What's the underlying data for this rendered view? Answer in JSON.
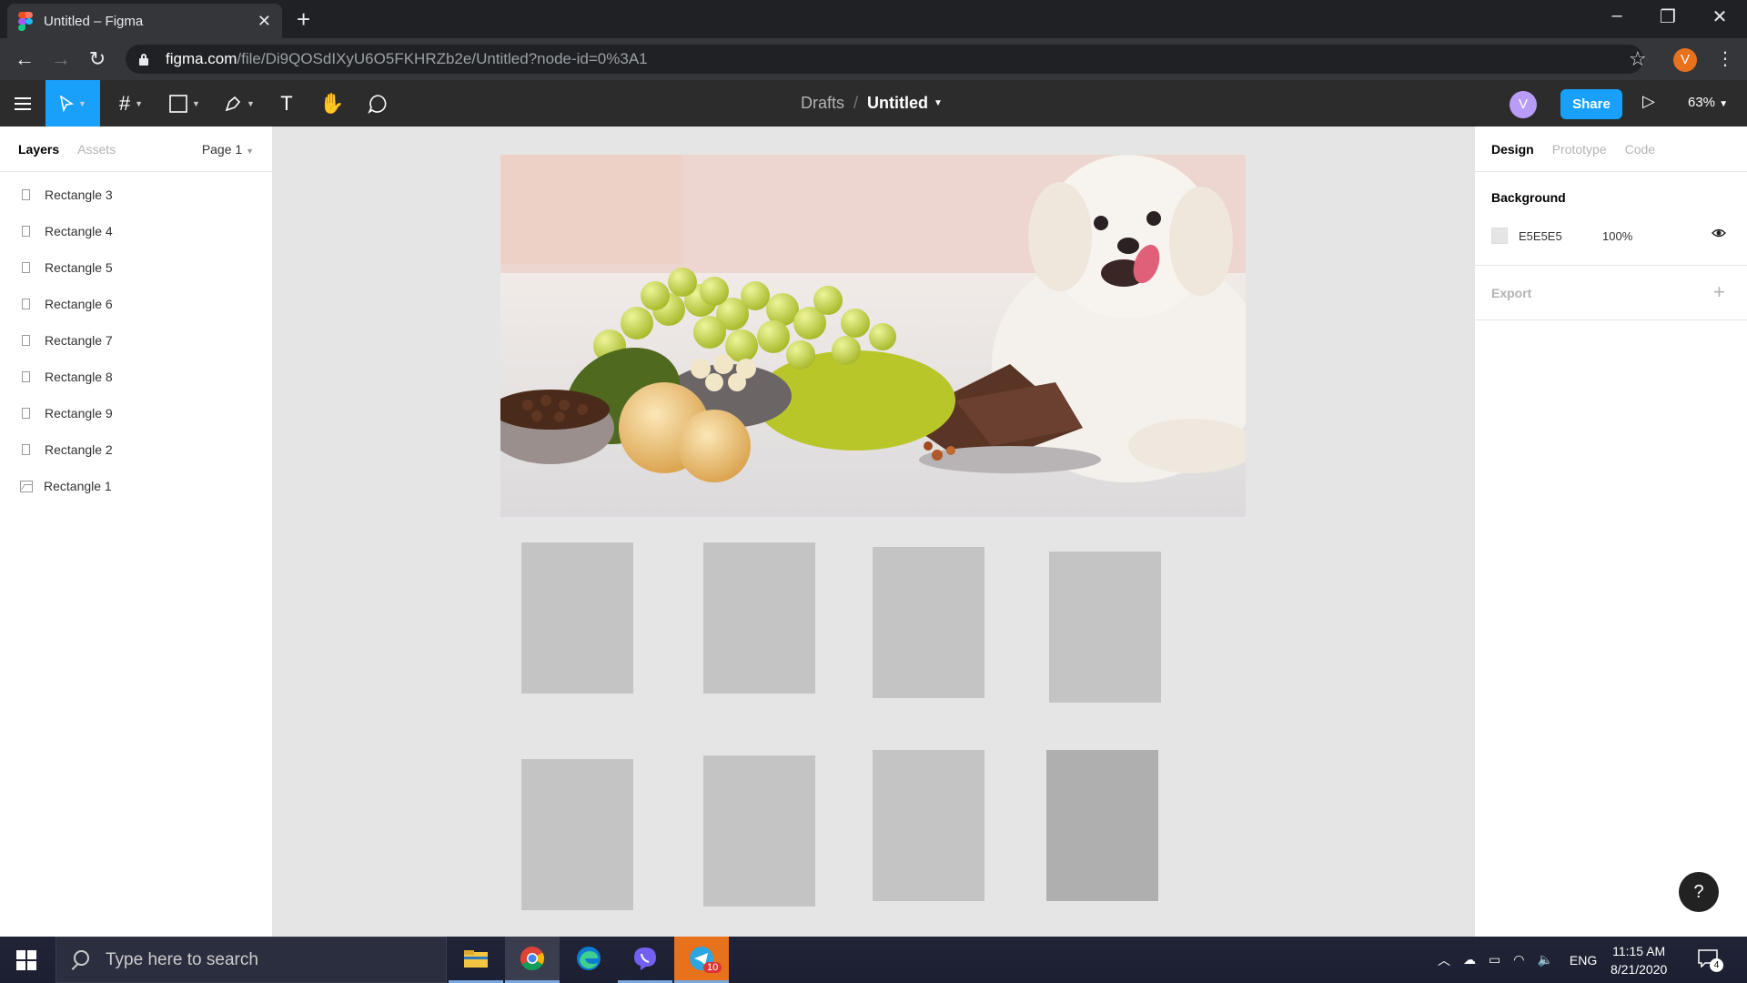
{
  "browser": {
    "tab_title": "Untitled – Figma",
    "url_host": "figma.com",
    "url_path": "/file/Di9QOSdIXyU6O5FKHRZb2e/Untitled?node-id=0%3A1",
    "profile_initial": "V"
  },
  "toolbar": {
    "breadcrumb_drafts": "Drafts",
    "breadcrumb_sep": "/",
    "file_name": "Untitled",
    "user_initial": "V",
    "share_label": "Share",
    "zoom": "63%"
  },
  "left_panel": {
    "tab_layers": "Layers",
    "tab_assets": "Assets",
    "page_selector": "Page 1",
    "layers": [
      {
        "name": "Rectangle 3"
      },
      {
        "name": "Rectangle 4"
      },
      {
        "name": "Rectangle 5"
      },
      {
        "name": "Rectangle 6"
      },
      {
        "name": "Rectangle 7"
      },
      {
        "name": "Rectangle 8"
      },
      {
        "name": "Rectangle 9"
      },
      {
        "name": "Rectangle 2"
      },
      {
        "name": "Rectangle 1"
      }
    ]
  },
  "right_panel": {
    "tab_design": "Design",
    "tab_prototype": "Prototype",
    "tab_code": "Code",
    "background_title": "Background",
    "background_hex": "E5E5E5",
    "background_opacity": "100%",
    "background_color": "#e5e5e5",
    "export_title": "Export"
  },
  "help_label": "?",
  "colors": {
    "accent": "#18a0fb",
    "toolbar": "#2c2c2c",
    "placeholder_rect": "#c4c4c4"
  },
  "taskbar": {
    "search_placeholder": "Type here to search",
    "telegram_badge": "10",
    "language": "ENG",
    "time": "11:15 AM",
    "date": "8/21/2020",
    "notification_count": "4"
  }
}
